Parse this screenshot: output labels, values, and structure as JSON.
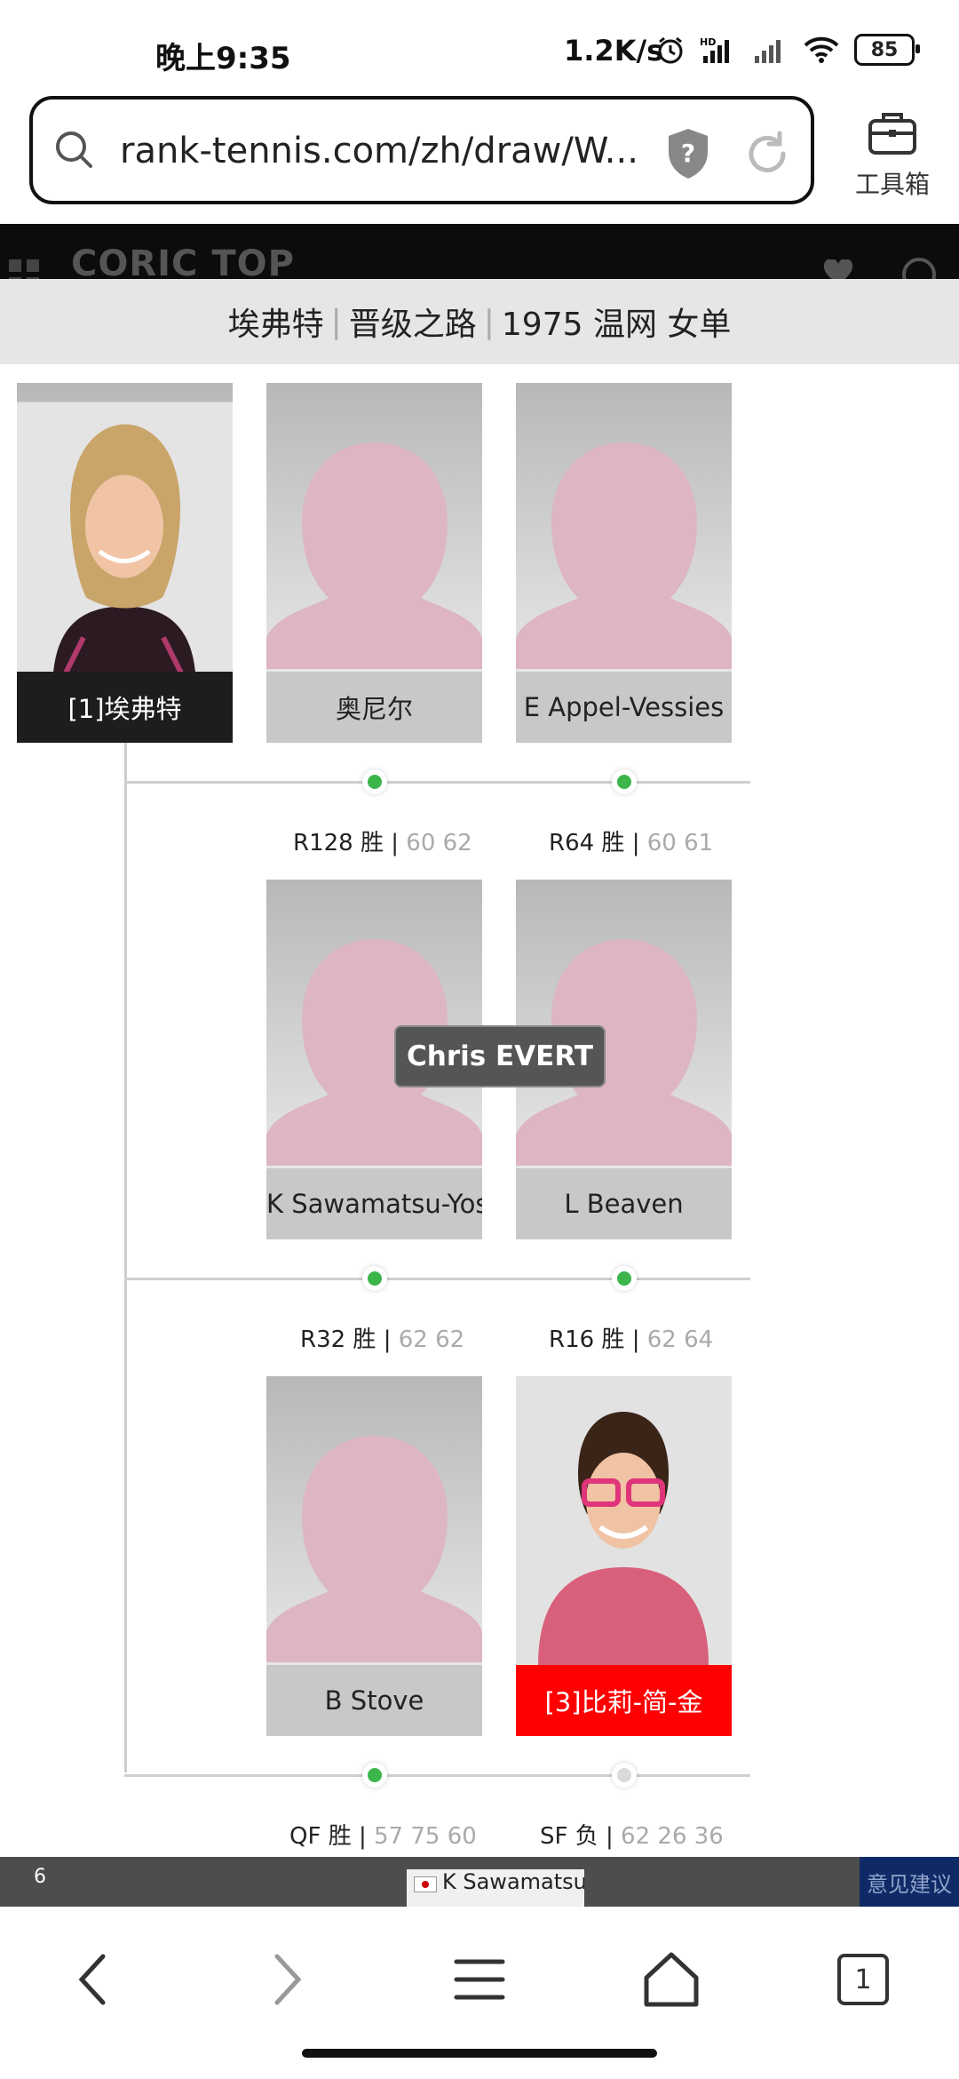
{
  "status_bar": {
    "time": "晚上9:35",
    "net_speed": "1.2K/s",
    "battery": "85",
    "icons": [
      "alarm-icon",
      "hd-signal-icon",
      "signal-icon",
      "wifi-icon",
      "battery-icon"
    ]
  },
  "browser": {
    "url": "rank-tennis.com/zh/draw/W...",
    "toolbox_label": "工具箱"
  },
  "site": {
    "logo": "CORIC TOP"
  },
  "banner": {
    "player": "埃弗特",
    "section": "晋级之路",
    "event": "1975 温网 女单"
  },
  "player_card": {
    "name": "[1]埃弗特",
    "tooltip": "Chris EVERT"
  },
  "opponents": [
    {
      "name": "奥尼尔"
    },
    {
      "name": "E Appel-Vessies"
    },
    {
      "name": "K Sawamatsu-Yoshid"
    },
    {
      "name": "L Beaven"
    },
    {
      "name": "B Stove"
    },
    {
      "name": "[3]比莉-简-金"
    }
  ],
  "rounds": [
    {
      "round": "R128",
      "outcome": "胜",
      "score": "60 62",
      "win": true
    },
    {
      "round": "R64",
      "outcome": "胜",
      "score": "60 61",
      "win": true
    },
    {
      "round": "R32",
      "outcome": "胜",
      "score": "62 62",
      "win": true
    },
    {
      "round": "R16",
      "outcome": "胜",
      "score": "62 64",
      "win": true
    },
    {
      "round": "QF",
      "outcome": "胜",
      "score": "57 75 60",
      "win": true
    },
    {
      "round": "SF",
      "outcome": "负",
      "score": "62 26 36",
      "win": false
    }
  ],
  "bottom_table": {
    "number": "6",
    "name": "K Sawamatsu-",
    "feedback": "意见建议"
  },
  "nav": {
    "tab_count": "1"
  },
  "colors": {
    "win": "#3cb54a",
    "loss": "#dadada",
    "seed_red": "#ff0000",
    "selected": "#1d1d1d"
  }
}
